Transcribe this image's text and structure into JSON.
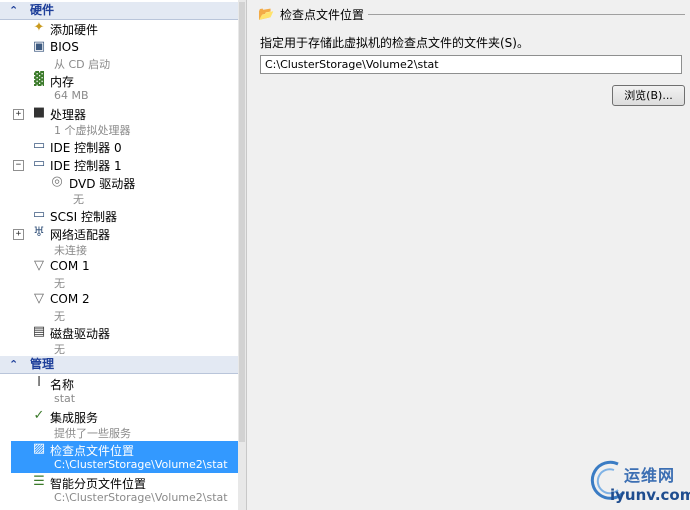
{
  "sections": {
    "hardware": "硬件",
    "management": "管理"
  },
  "hardware_items": [
    {
      "name": "添加硬件",
      "icon": "add-hardware-icon"
    },
    {
      "name": "BIOS",
      "sub": "从 CD 启动",
      "icon": "bios-icon"
    },
    {
      "name": "内存",
      "sub": "64 MB",
      "icon": "memory-icon"
    },
    {
      "name": "处理器",
      "sub": "1 个虚拟处理器",
      "icon": "processor-icon",
      "expander": "+"
    },
    {
      "name": "IDE 控制器 0",
      "icon": "ide-controller-icon"
    },
    {
      "name": "IDE 控制器 1",
      "icon": "ide-controller-icon",
      "expander": "−"
    },
    {
      "name": "DVD 驱动器",
      "sub": "无",
      "icon": "dvd-drive-icon"
    },
    {
      "name": "SCSI 控制器",
      "icon": "scsi-controller-icon"
    },
    {
      "name": "网络适配器",
      "sub": "未连接",
      "icon": "network-adapter-icon",
      "expander": "+"
    },
    {
      "name": "COM 1",
      "sub": "无",
      "icon": "com-port-icon"
    },
    {
      "name": "COM 2",
      "sub": "无",
      "icon": "com-port-icon"
    },
    {
      "name": "磁盘驱动器",
      "sub": "无",
      "icon": "floppy-drive-icon"
    }
  ],
  "management_items": [
    {
      "name": "名称",
      "sub": "stat",
      "icon": "name-icon"
    },
    {
      "name": "集成服务",
      "sub": "提供了一些服务",
      "icon": "integration-services-icon"
    },
    {
      "name": "检查点文件位置",
      "sub": "C:\\ClusterStorage\\Volume2\\stat",
      "icon": "checkpoint-folder-icon",
      "selected": true
    },
    {
      "name": "智能分页文件位置",
      "sub": "C:\\ClusterStorage\\Volume2\\stat",
      "icon": "smart-paging-icon"
    }
  ],
  "details": {
    "title": "检查点文件位置",
    "description": "指定用于存储此虚拟机的检查点文件的文件夹(S)。",
    "path_value": "C:\\ClusterStorage\\Volume2\\stat",
    "browse_label": "浏览(B)..."
  },
  "watermark": {
    "cn": "运维网",
    "en": "iyunv.com"
  },
  "colors": {
    "selection": "#3399ff",
    "section_text": "#1e3f9a",
    "section_bg": "#e3e9f3",
    "subtext": "#8a8a8a"
  }
}
